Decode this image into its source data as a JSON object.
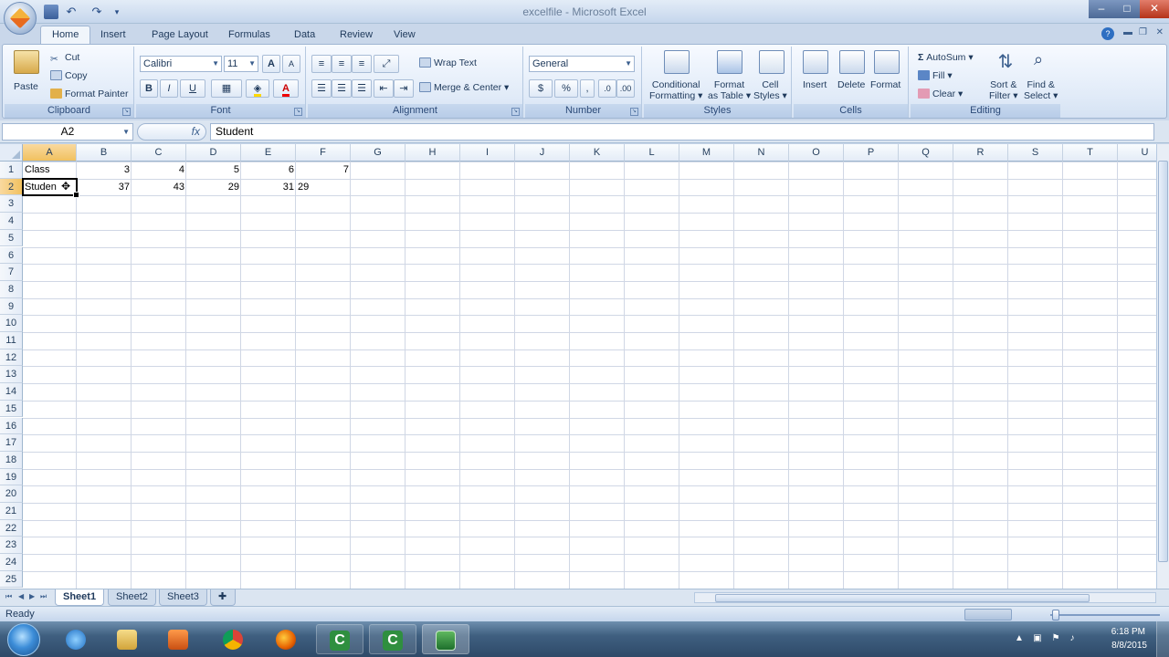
{
  "window": {
    "title": "excelfile - Microsoft Excel",
    "minimize": "–",
    "maximize": "□",
    "close": "✕"
  },
  "qat": {
    "undo": "↶",
    "redo": "↷",
    "more": "▾"
  },
  "tabs": [
    "Home",
    "Insert",
    "Page Layout",
    "Formulas",
    "Data",
    "Review",
    "View"
  ],
  "active_tab": "Home",
  "ribbon": {
    "clipboard": {
      "label": "Clipboard",
      "paste": "Paste",
      "cut": "Cut",
      "copy": "Copy",
      "format_painter": "Format Painter"
    },
    "font": {
      "label": "Font",
      "font_name": "Calibri",
      "font_size": "11",
      "grow": "A",
      "shrink": "A",
      "bold": "B",
      "italic": "I",
      "underline": "U",
      "font_color": "A"
    },
    "alignment": {
      "label": "Alignment",
      "wrap_text": "Wrap Text",
      "merge_center": "Merge & Center"
    },
    "number": {
      "label": "Number",
      "format": "General",
      "currency": "$",
      "percent": "%",
      "comma": ","
    },
    "styles": {
      "label": "Styles",
      "conditional_1": "Conditional",
      "conditional_2": "Formatting",
      "format_table_1": "Format",
      "format_table_2": "as Table",
      "cell_styles_1": "Cell",
      "cell_styles_2": "Styles"
    },
    "cells": {
      "label": "Cells",
      "insert": "Insert",
      "delete": "Delete",
      "format": "Format"
    },
    "editing": {
      "label": "Editing",
      "autosum": "AutoSum",
      "fill": "Fill",
      "clear": "Clear",
      "sort_1": "Sort &",
      "sort_2": "Filter",
      "find_1": "Find &",
      "find_2": "Select"
    }
  },
  "formula_bar": {
    "name_box": "A2",
    "fx": "fx",
    "formula": "Student"
  },
  "columns": [
    "A",
    "B",
    "C",
    "D",
    "E",
    "F",
    "G",
    "H",
    "I",
    "J",
    "K",
    "L",
    "M",
    "N",
    "O",
    "P",
    "Q",
    "R",
    "S",
    "T",
    "U"
  ],
  "rows": [
    "1",
    "2",
    "3",
    "4",
    "5",
    "6",
    "7",
    "8",
    "9",
    "10",
    "11",
    "12",
    "13",
    "14",
    "15",
    "16",
    "17",
    "18",
    "19",
    "20",
    "21",
    "22",
    "23",
    "24",
    "25"
  ],
  "cells": {
    "A1": "Class",
    "B1": "3",
    "C1": "4",
    "D1": "5",
    "E1": "6",
    "F1": "7",
    "A2": "Studen",
    "B2": "37",
    "C2": "43",
    "D2": "29",
    "E2": "31",
    "F2": "29"
  },
  "selected_cell": "A2",
  "sheets": [
    "Sheet1",
    "Sheet2",
    "Sheet3"
  ],
  "active_sheet": "Sheet1",
  "status": {
    "text": "Ready"
  },
  "taskbar": {
    "clock_time": "6:18 PM",
    "clock_date": "8/8/2015"
  },
  "colors": {
    "ribbon_bg": "#dfe9f5",
    "selected_header": "#f1c15f",
    "grid_line": "#d0d7e5",
    "taskbar": "#3f5f80"
  }
}
